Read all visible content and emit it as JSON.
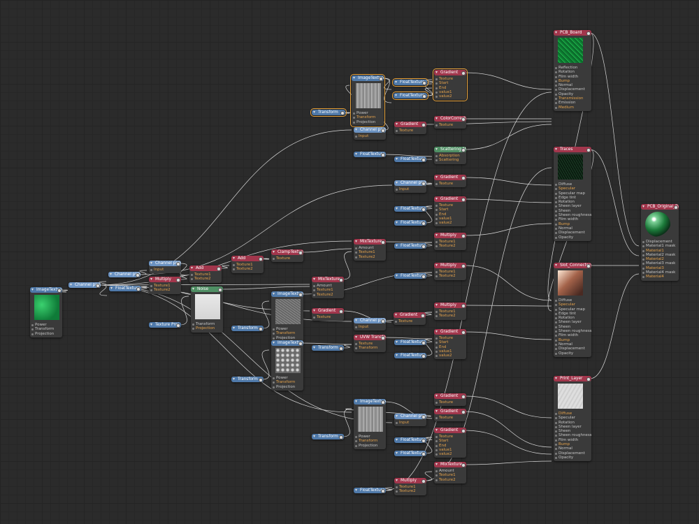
{
  "app": {
    "background": "#2b2b2b"
  },
  "colors": {
    "texture_node": "#4f79a9",
    "material_node": "#a2364c",
    "geometry_node": "#4f8f64",
    "selection": "#e8a33c"
  },
  "nodes": [
    {
      "title": "PCB_Board",
      "color": "red",
      "thumb": "circuit",
      "rows": [
        {
          "t": "Reflection"
        },
        {
          "t": "Rotation"
        },
        {
          "t": "Film width"
        },
        {
          "t": "Bump",
          "o": true
        },
        {
          "t": "Normal"
        },
        {
          "t": "Displacement"
        },
        {
          "t": "Opacity"
        },
        {
          "t": "Transmission",
          "o": true
        },
        {
          "t": "Emission"
        },
        {
          "t": "Medium",
          "o": true
        }
      ]
    },
    {
      "title": "ImageTexture",
      "color": "blue",
      "thumb": "gray",
      "selected": true,
      "rows": [
        {
          "t": "Power"
        },
        {
          "t": "Transform",
          "o": true
        },
        {
          "t": "Projection"
        }
      ]
    },
    {
      "title": "FloatTexture",
      "color": "blue",
      "selected": true,
      "rows": []
    },
    {
      "title": "FloatTexture",
      "color": "blue",
      "selected": true,
      "rows": []
    },
    {
      "title": "Gradient",
      "color": "red",
      "selected": true,
      "rows": [
        {
          "t": "Texture",
          "o": true
        },
        {
          "t": "Start",
          "o": true
        },
        {
          "t": "End",
          "o": true
        },
        {
          "t": "value1",
          "o": true
        },
        {
          "t": "value2",
          "o": true
        }
      ]
    },
    {
      "title": "Transform",
      "color": "blue",
      "selected": true,
      "rows": []
    },
    {
      "title": "ColorCorrection",
      "color": "red",
      "rows": [
        {
          "t": "Texture",
          "o": true
        }
      ]
    },
    {
      "title": "Gradient",
      "color": "red",
      "rows": [
        {
          "t": "Texture",
          "o": true
        }
      ]
    },
    {
      "title": "Channel picker",
      "color": "lblue",
      "rows": [
        {
          "t": "Input",
          "o": true
        }
      ]
    },
    {
      "title": "Scattering Med",
      "color": "green",
      "rows": [
        {
          "t": "Absorption",
          "o": true
        },
        {
          "t": "Scattering",
          "o": true
        }
      ]
    },
    {
      "title": "FloatTexture",
      "color": "blue",
      "rows": []
    },
    {
      "title": "FloatTexture",
      "color": "blue",
      "rows": []
    },
    {
      "title": "Traces",
      "color": "red",
      "thumb": "dark",
      "rows": [
        {
          "t": "Diffuse"
        },
        {
          "t": "Specular",
          "o": true
        },
        {
          "t": "Specular map"
        },
        {
          "t": "Edge tint"
        },
        {
          "t": "Rotation"
        },
        {
          "t": "Sheen layer"
        },
        {
          "t": "Sheen"
        },
        {
          "t": "Sheen roughness"
        },
        {
          "t": "Film width"
        },
        {
          "t": "Bump",
          "o": true
        },
        {
          "t": "Normal"
        },
        {
          "t": "Displacement"
        },
        {
          "t": "Opacity"
        }
      ]
    },
    {
      "title": "Gradient",
      "color": "red",
      "rows": [
        {
          "t": "Texture",
          "o": true
        }
      ]
    },
    {
      "title": "Channel picker",
      "color": "lblue",
      "rows": [
        {
          "t": "Input",
          "o": true
        }
      ]
    },
    {
      "title": "Gradient",
      "color": "red",
      "rows": [
        {
          "t": "Texture",
          "o": true
        },
        {
          "t": "Start",
          "o": true
        },
        {
          "t": "End",
          "o": true
        },
        {
          "t": "value1",
          "o": true
        },
        {
          "t": "value2",
          "o": true
        }
      ]
    },
    {
      "title": "FloatTexture",
      "color": "blue",
      "rows": []
    },
    {
      "title": "FloatTexture",
      "color": "blue",
      "rows": []
    },
    {
      "title": "PCB_Original_Bar",
      "color": "red",
      "thumb": "sphere",
      "rows": [
        {
          "t": "Displacement"
        },
        {
          "t": "Material1 mask"
        },
        {
          "t": "Material1",
          "o": true
        },
        {
          "t": "Material2 mask"
        },
        {
          "t": "Material2",
          "o": true
        },
        {
          "t": "Material3 mask"
        },
        {
          "t": "Material3",
          "o": true
        },
        {
          "t": "Material4 mask"
        },
        {
          "t": "Material4",
          "o": true
        }
      ]
    },
    {
      "title": "Multiply",
      "color": "red",
      "rows": [
        {
          "t": "Texture1",
          "o": true
        },
        {
          "t": "Texture2",
          "o": true
        }
      ]
    },
    {
      "title": "MixTexture",
      "color": "red",
      "rows": [
        {
          "t": "Amount"
        },
        {
          "t": "Texture1",
          "o": true
        },
        {
          "t": "Texture2",
          "o": true
        }
      ]
    },
    {
      "title": "FloatTexture",
      "color": "blue",
      "rows": []
    },
    {
      "title": "ClampTexture",
      "color": "red",
      "rows": [
        {
          "t": "Texture",
          "o": true
        }
      ]
    },
    {
      "title": "Add",
      "color": "red",
      "rows": [
        {
          "t": "Texture1",
          "o": true
        },
        {
          "t": "Texture2",
          "o": true
        }
      ]
    },
    {
      "title": "Add",
      "color": "red",
      "rows": [
        {
          "t": "Texture1",
          "o": true
        },
        {
          "t": "Texture2",
          "o": true
        }
      ]
    },
    {
      "title": "Channel picker",
      "color": "lblue",
      "rows": [
        {
          "t": "Input",
          "o": true
        }
      ]
    },
    {
      "title": "Channel picker",
      "color": "lblue",
      "rows": []
    },
    {
      "title": "Multiply",
      "color": "red",
      "rows": [
        {
          "t": "Texture1",
          "o": true
        },
        {
          "t": "Texture2",
          "o": true
        }
      ]
    },
    {
      "title": "FloatTexture",
      "color": "blue",
      "rows": []
    },
    {
      "title": "Channel picker",
      "color": "lblue",
      "rows": []
    },
    {
      "title": "ImageTexture",
      "color": "blue",
      "thumb": "green",
      "rows": [
        {
          "t": "Power"
        },
        {
          "t": "Transform"
        },
        {
          "t": "Projection"
        }
      ]
    },
    {
      "title": "MixTexture",
      "color": "red",
      "rows": [
        {
          "t": "Amount"
        },
        {
          "t": "Texture1",
          "o": true
        },
        {
          "t": "Texture2",
          "o": true
        }
      ]
    },
    {
      "title": "FloatTexture",
      "color": "blue",
      "rows": []
    },
    {
      "title": "Multiply",
      "color": "red",
      "rows": [
        {
          "t": "Texture1",
          "o": true
        },
        {
          "t": "Texture2",
          "o": true
        }
      ]
    },
    {
      "title": "Noise",
      "color": "green",
      "thumb": "white",
      "rows": [
        {
          "t": "Transform"
        },
        {
          "t": "Projection",
          "o": true
        }
      ]
    },
    {
      "title": "ImageTexture",
      "color": "blue",
      "thumb": "noise",
      "rows": [
        {
          "t": "Power"
        },
        {
          "t": "Transform",
          "o": true
        },
        {
          "t": "Projection"
        }
      ]
    },
    {
      "title": "Slot_Connectors",
      "color": "red",
      "thumb": "copper",
      "rows": [
        {
          "t": "Diffuse"
        },
        {
          "t": "Specular",
          "o": true
        },
        {
          "t": "Specular map"
        },
        {
          "t": "Edge tint"
        },
        {
          "t": "Rotation"
        },
        {
          "t": "Sheen layer"
        },
        {
          "t": "Sheen"
        },
        {
          "t": "Sheen roughness"
        },
        {
          "t": "Film width"
        },
        {
          "t": "Bump",
          "o": true
        },
        {
          "t": "Normal"
        },
        {
          "t": "Displacement"
        },
        {
          "t": "Opacity"
        }
      ]
    },
    {
      "title": "Multiply",
      "color": "red",
      "rows": [
        {
          "t": "Texture1",
          "o": true
        },
        {
          "t": "Texture2",
          "o": true
        }
      ]
    },
    {
      "title": "Gradient",
      "color": "red",
      "rows": [
        {
          "t": "Texture",
          "o": true
        }
      ]
    },
    {
      "title": "Gradient",
      "color": "red",
      "rows": [
        {
          "t": "Texture",
          "o": true
        }
      ]
    },
    {
      "title": "Channel picker",
      "color": "lblue",
      "rows": [
        {
          "t": "Input",
          "o": true
        }
      ]
    },
    {
      "title": "Texture Proj",
      "color": "blue",
      "rows": []
    },
    {
      "title": "Transform",
      "color": "blue",
      "rows": []
    },
    {
      "title": "Gradient",
      "color": "red",
      "rows": [
        {
          "t": "Texture",
          "o": true
        },
        {
          "t": "Start",
          "o": true
        },
        {
          "t": "End",
          "o": true
        },
        {
          "t": "value1",
          "o": true
        },
        {
          "t": "value2",
          "o": true
        }
      ]
    },
    {
      "title": "ImageTexture",
      "color": "blue",
      "thumb": "bumps",
      "rows": [
        {
          "t": "Power"
        },
        {
          "t": "Transform",
          "o": true
        },
        {
          "t": "Projection"
        }
      ]
    },
    {
      "title": "UVW Transform",
      "color": "red",
      "rows": [
        {
          "t": "Texture",
          "o": true
        },
        {
          "t": "Transform",
          "o": true
        }
      ]
    },
    {
      "title": "Transform",
      "color": "blue",
      "rows": []
    },
    {
      "title": "FloatTexture",
      "color": "blue",
      "rows": []
    },
    {
      "title": "FloatTexture",
      "color": "blue",
      "rows": []
    },
    {
      "title": "Transform",
      "color": "blue",
      "rows": []
    },
    {
      "title": "Print_Layer",
      "color": "red",
      "thumb": "paper",
      "rows": [
        {
          "t": "Diffuse",
          "o": true
        },
        {
          "t": "Specular"
        },
        {
          "t": "Rotation"
        },
        {
          "t": "Sheen layer"
        },
        {
          "t": "Sheen"
        },
        {
          "t": "Sheen roughness"
        },
        {
          "t": "Film width"
        },
        {
          "t": "Bump",
          "o": true
        },
        {
          "t": "Normal"
        },
        {
          "t": "Displacement"
        },
        {
          "t": "Opacity"
        }
      ]
    },
    {
      "title": "Gradient",
      "color": "red",
      "rows": [
        {
          "t": "Texture",
          "o": true
        }
      ]
    },
    {
      "title": "ImageTexture",
      "color": "blue",
      "thumb": "gray",
      "rows": [
        {
          "t": "Power"
        },
        {
          "t": "Transform",
          "o": true
        },
        {
          "t": "Projection"
        }
      ]
    },
    {
      "title": "Gradient",
      "color": "red",
      "rows": [
        {
          "t": "Texture",
          "o": true
        }
      ]
    },
    {
      "title": "Channel picker",
      "color": "lblue",
      "rows": [
        {
          "t": "Input",
          "o": true
        }
      ]
    },
    {
      "title": "Gradient",
      "color": "red",
      "rows": [
        {
          "t": "Texture",
          "o": true
        },
        {
          "t": "Start",
          "o": true
        },
        {
          "t": "End",
          "o": true
        },
        {
          "t": "value1",
          "o": true
        },
        {
          "t": "value2",
          "o": true
        }
      ]
    },
    {
      "title": "Transform",
      "color": "blue",
      "rows": []
    },
    {
      "title": "FloatTexture",
      "color": "blue",
      "rows": []
    },
    {
      "title": "FloatTexture",
      "color": "blue",
      "rows": []
    },
    {
      "title": "MixTexture",
      "color": "red",
      "rows": [
        {
          "t": "Amount"
        },
        {
          "t": "Texture1",
          "o": true
        },
        {
          "t": "Texture2",
          "o": true
        }
      ]
    },
    {
      "title": "Multiply",
      "color": "red",
      "rows": [
        {
          "t": "Texture1",
          "o": true
        },
        {
          "t": "Texture2",
          "o": true
        }
      ]
    },
    {
      "title": "FloatTexture",
      "color": "blue",
      "rows": []
    }
  ]
}
